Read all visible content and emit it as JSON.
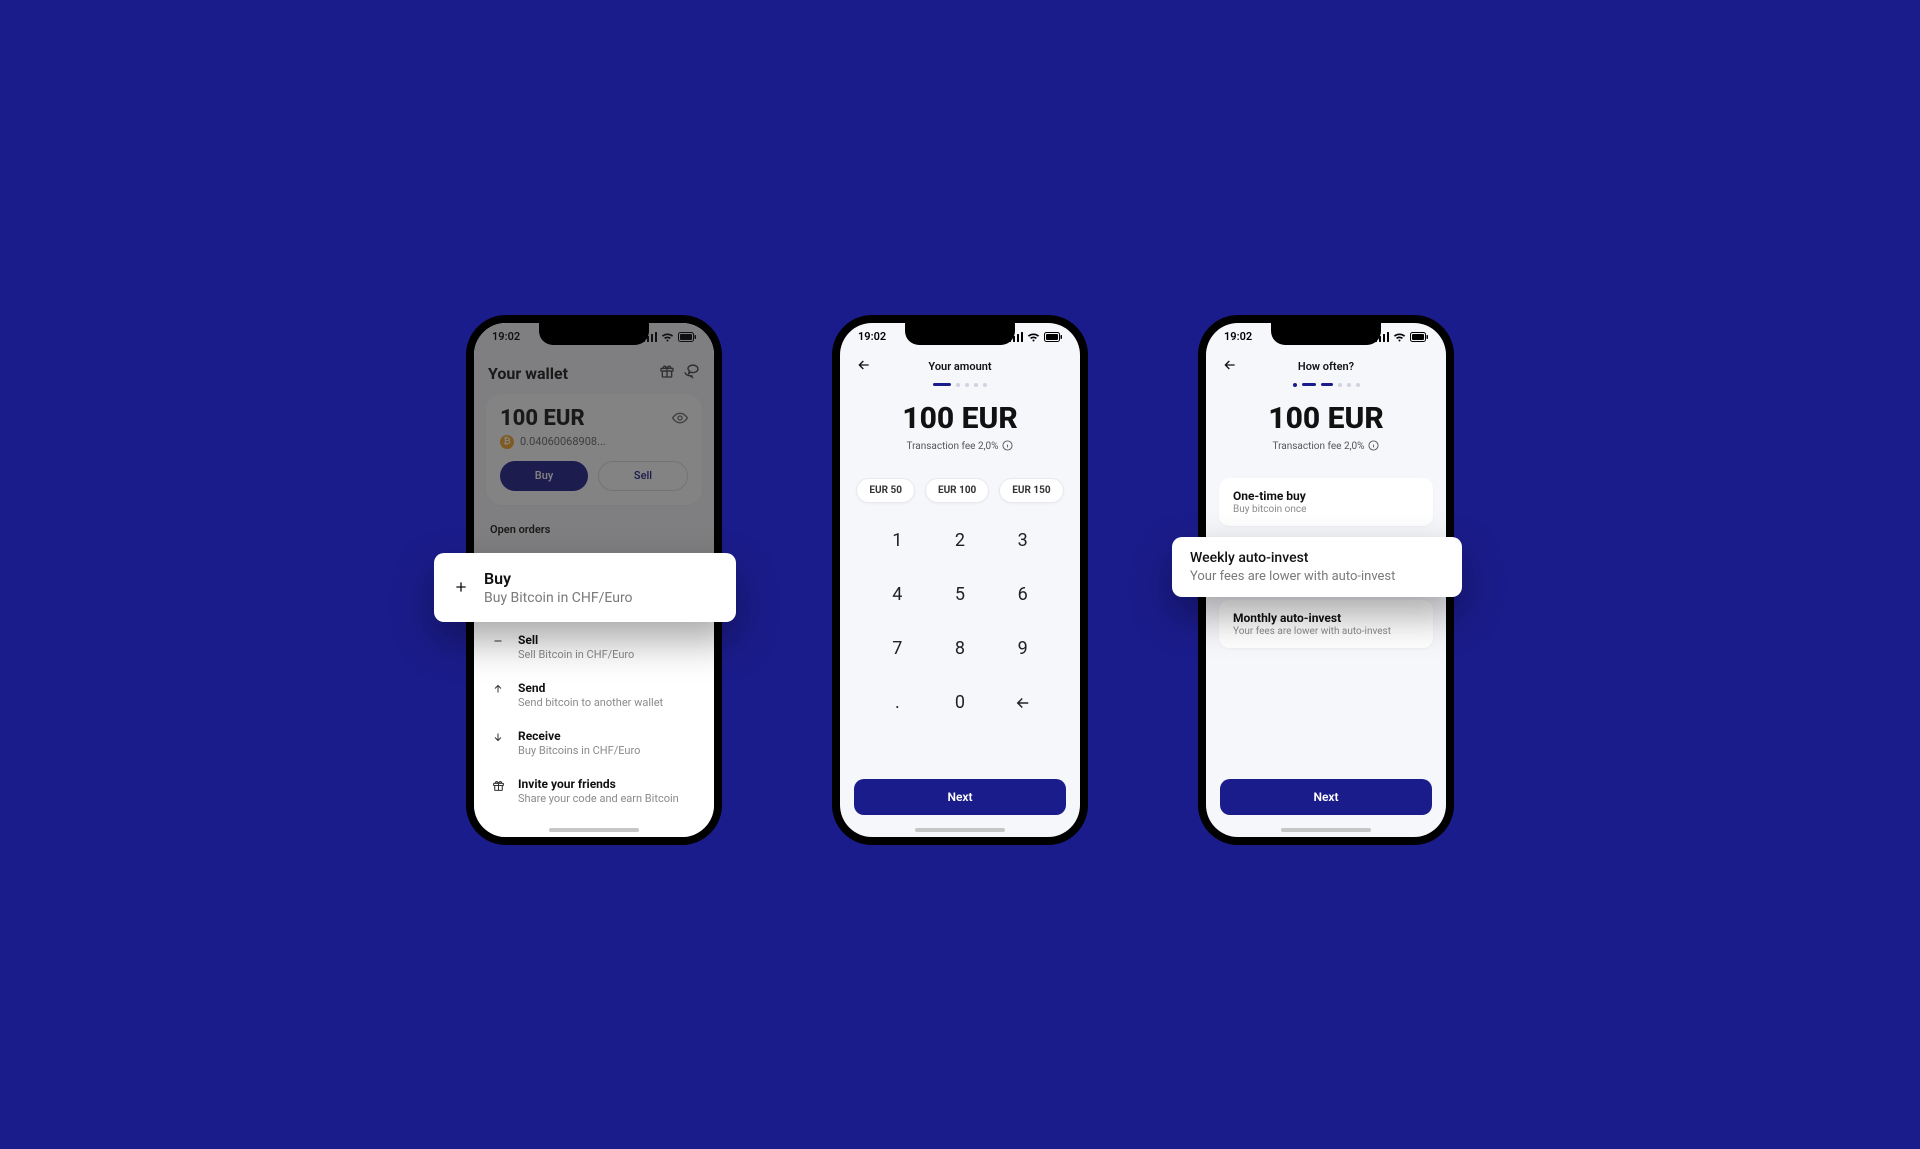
{
  "status": {
    "time": "19:02"
  },
  "colors": {
    "brand": "#1b1c8b"
  },
  "phone1": {
    "walletTitle": "Your wallet",
    "balance": "100 EUR",
    "balanceBtc": "0.04060068908...",
    "buyLabel": "Buy",
    "sellLabel": "Sell",
    "openOrders": "Open orders",
    "popout": {
      "title": "Buy",
      "subtitle": "Buy Bitcoin in CHF/Euro"
    },
    "actions": [
      {
        "icon": "minus",
        "title": "Sell",
        "subtitle": "Sell Bitcoin in CHF/Euro"
      },
      {
        "icon": "arrow-up",
        "title": "Send",
        "subtitle": "Send bitcoin to another wallet"
      },
      {
        "icon": "arrow-down",
        "title": "Receive",
        "subtitle": "Buy Bitcoins in CHF/Euro"
      },
      {
        "icon": "gift",
        "title": "Invite your friends",
        "subtitle": "Share your code and earn Bitcoin"
      }
    ]
  },
  "phone2": {
    "navTitle": "Your amount",
    "amount": "100 EUR",
    "feeText": "Transaction fee 2,0%",
    "presets": [
      "EUR 50",
      "EUR 100",
      "EUR 150"
    ],
    "keys": [
      "1",
      "2",
      "3",
      "4",
      "5",
      "6",
      "7",
      "8",
      "9",
      ".",
      "0",
      "back"
    ],
    "nextLabel": "Next"
  },
  "phone3": {
    "navTitle": "How often?",
    "amount": "100 EUR",
    "feeText": "Transaction fee 2,0%",
    "option1": {
      "title": "One-time buy",
      "subtitle": "Buy bitcoin once"
    },
    "popout": {
      "title": "Weekly auto-invest",
      "subtitle": "Your fees are lower with auto-invest"
    },
    "option3": {
      "title": "Monthly auto-invest",
      "subtitle": "Your fees are lower with auto-invest"
    },
    "nextLabel": "Next"
  }
}
